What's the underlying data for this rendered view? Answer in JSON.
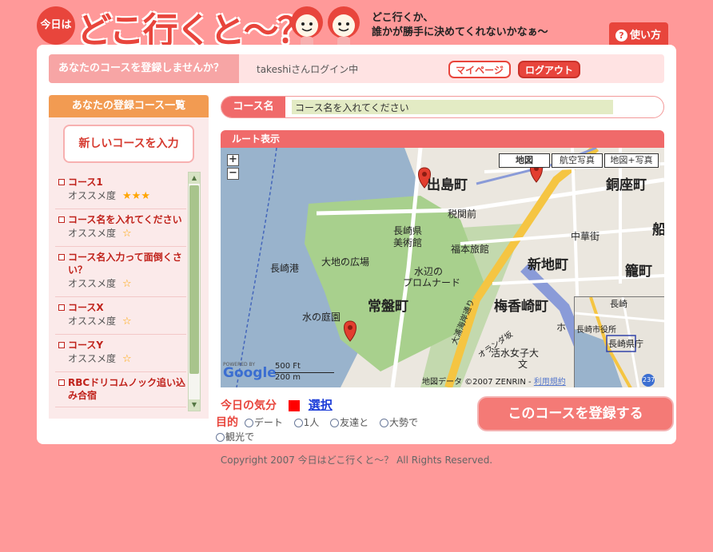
{
  "header": {
    "badge": "今日は",
    "title": "どこ行くと〜？",
    "tagline_1": "どこ行くか、",
    "tagline_2": "誰かが勝手に決めてくれないかなぁ〜",
    "help_label": "使い方"
  },
  "topbar": {
    "cta": "あなたのコースを登録しませんか？",
    "login_text": "takeshiさんログイン中",
    "mypage_label": "マイページ",
    "logout_label": "ログアウト"
  },
  "sidebar": {
    "heading": "あなたの登録コース一覧",
    "new_course_label": "新しいコースを入力",
    "rating_label": "オススメ度",
    "courses": [
      {
        "title": "コース1",
        "stars": "★★★"
      },
      {
        "title": "コース名を入れてください",
        "stars": "☆"
      },
      {
        "title": "コース名入力って面倒くさい？",
        "stars": "☆"
      },
      {
        "title": "コースX",
        "stars": "☆"
      },
      {
        "title": "コースY",
        "stars": "☆"
      },
      {
        "title": "RBCドリコムノック追い込み合宿",
        "stars": ""
      }
    ]
  },
  "course_name": {
    "label": "コース名",
    "value": "コース名を入れてください"
  },
  "map": {
    "heading": "ルート表示",
    "zoom_in": "+",
    "zoom_out": "−",
    "types": [
      "地図",
      "航空写真",
      "地図+写真"
    ],
    "labels": {
      "dejima": "出島町",
      "dozamachi": "銅座町",
      "zeikan": "税関前",
      "nagasaki_museum_1": "長崎県",
      "nagasaki_museum_2": "美術館",
      "fukumoto": "福本旅館",
      "chukagai": "中華街",
      "shinchi": "新地町",
      "kagomachi": "籠町",
      "port": "長崎港",
      "plaza": "大地の広場",
      "promenade_1": "水辺の",
      "promenade_2": "プロムナード",
      "tokiwa": "常盤町",
      "umegasaki": "梅香崎町",
      "water_garden": "水の庭園",
      "oura": "大浦海岸通り",
      "oranda": "オランダ坂",
      "kwassui": "活水女子大",
      "bun": "文",
      "ov_nagasaki": "長崎",
      "ov_pref": "長崎県庁",
      "ov_city": "長崎市役所",
      "ov_route": "237",
      "hoshi": "ホ",
      "kaku": "船"
    },
    "powered_by": "POWERED BY",
    "google": "Google",
    "scale_ft": "500 Ft",
    "scale_m": "200 m",
    "copyright_prefix": "地図データ ©2007 ZENRIN -",
    "terms": "利用規約"
  },
  "mood": {
    "label": "今日の気分",
    "color": "#ff0000",
    "select_label": "選択"
  },
  "purpose": {
    "label": "目的",
    "options": [
      "デート",
      "1人",
      "友達と",
      "大勢で",
      "観光で"
    ]
  },
  "submit_label": "このコースを登録する",
  "footer": "Copyright 2007 今日はどこ行くと〜？ All Rights Reserved."
}
